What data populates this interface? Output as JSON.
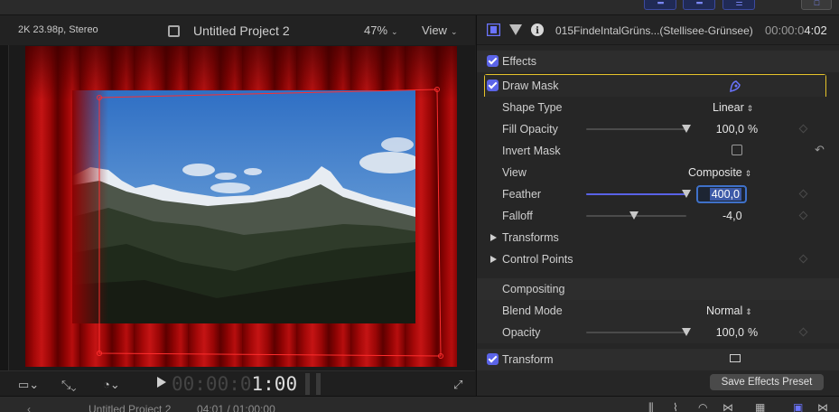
{
  "viewer": {
    "format": "2K 23.98p, Stereo",
    "project_title": "Untitled Project 2",
    "zoom": "47%",
    "view_menu": "View",
    "timecode_dim": "00:00:0",
    "timecode_bright": "1:00"
  },
  "inspector": {
    "clip_name": "015FindeIntalGrüns...(Stellisee-Grünsee)",
    "duration_dim": "00:00:0",
    "duration_bright": "4:02",
    "effects_label": "Effects",
    "draw_mask_label": "Draw Mask",
    "params": {
      "shape_type": {
        "label": "Shape Type",
        "value": "Linear"
      },
      "fill_opacity": {
        "label": "Fill Opacity",
        "value": "100,0",
        "unit": "%",
        "level": 1.0
      },
      "invert_mask": {
        "label": "Invert Mask",
        "checked": false
      },
      "view": {
        "label": "View",
        "value": "Composite"
      },
      "feather": {
        "label": "Feather",
        "value": "400,0",
        "level": 1.0
      },
      "falloff": {
        "label": "Falloff",
        "value": "-4,0",
        "level": 0.48
      },
      "transforms": {
        "label": "Transforms"
      },
      "control_points": {
        "label": "Control Points"
      }
    },
    "compositing": {
      "label": "Compositing",
      "blend_mode": {
        "label": "Blend Mode",
        "value": "Normal"
      },
      "opacity": {
        "label": "Opacity",
        "value": "100,0",
        "unit": "%",
        "level": 1.0
      }
    },
    "transform_label": "Transform",
    "save_preset_label": "Save Effects Preset"
  },
  "bottom_bar": {
    "project": "Untitled Project 2",
    "duration": "04:01 / 01:00:00"
  },
  "colors": {
    "accent": "#5b64e8",
    "highlight_box": "#e5c32a",
    "curtain_red": "#b70e0e"
  }
}
